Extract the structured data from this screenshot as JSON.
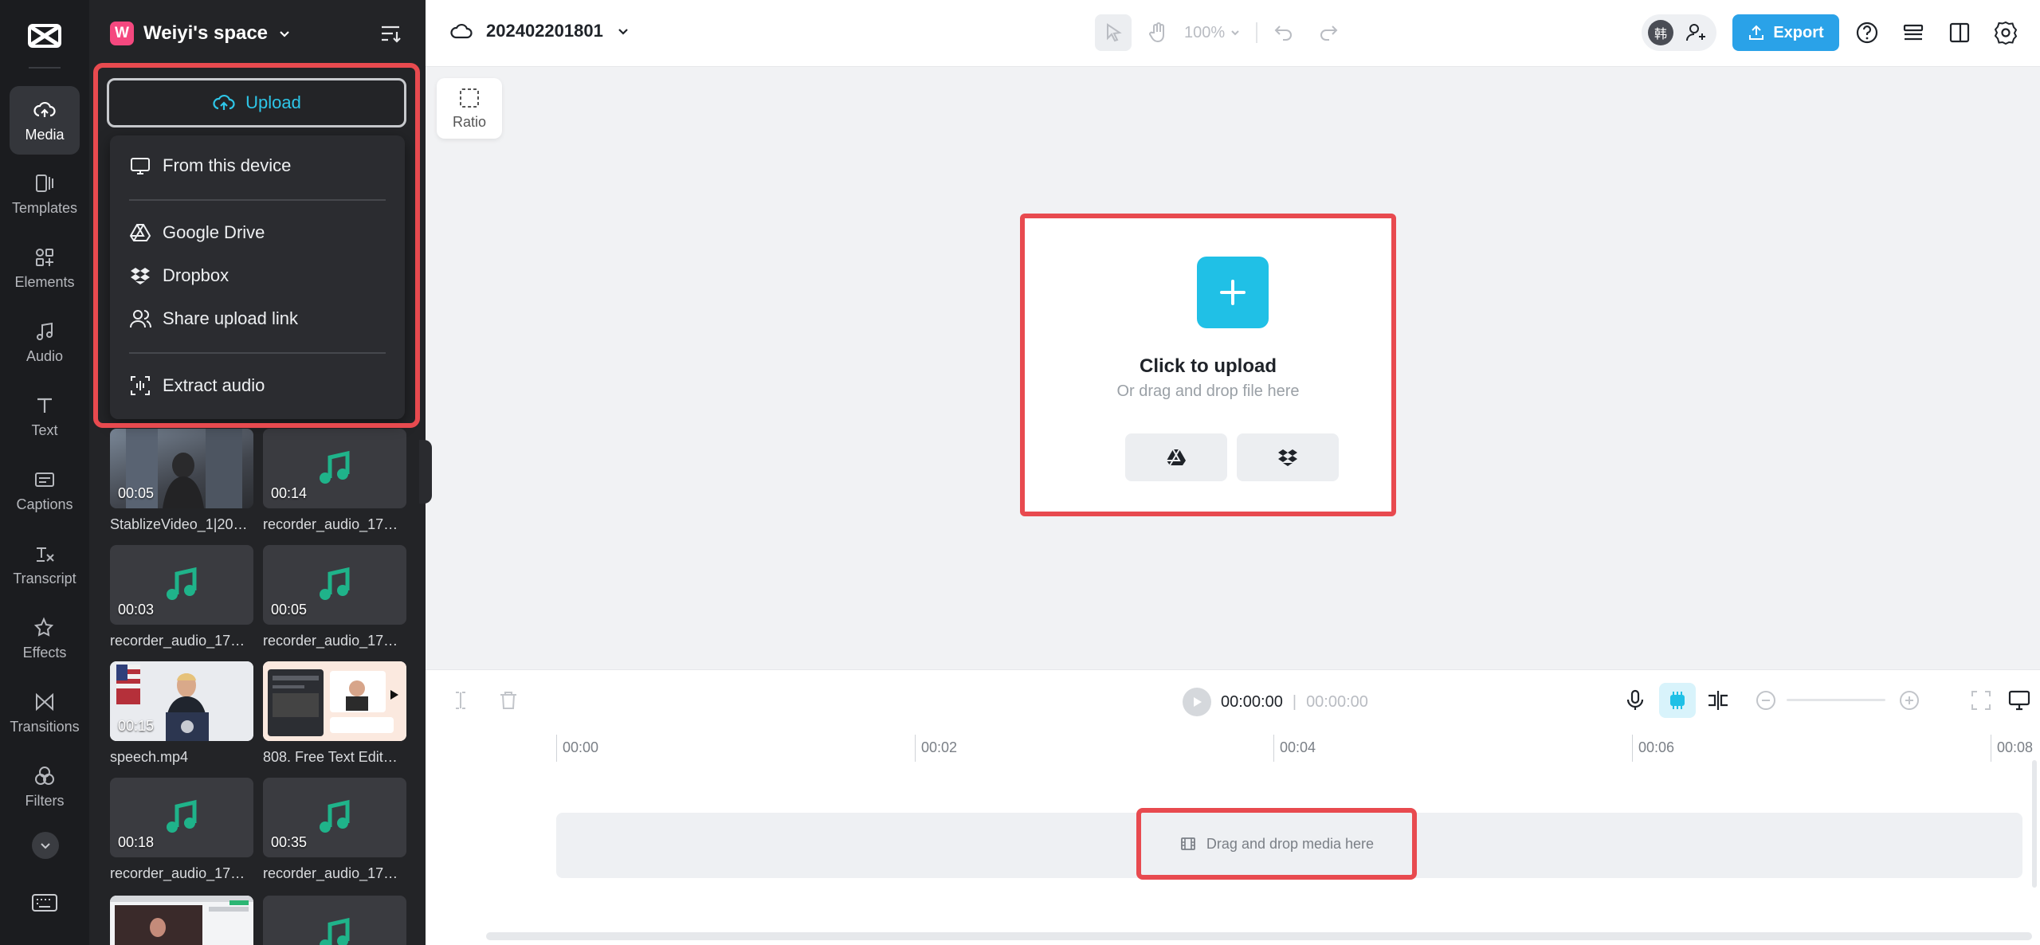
{
  "workspace": {
    "avatar_letter": "W",
    "name": "Weiyi's space"
  },
  "nav": [
    {
      "label": "Media",
      "icon": "cloud-upload-icon",
      "active": true
    },
    {
      "label": "Templates",
      "icon": "templates-icon"
    },
    {
      "label": "Elements",
      "icon": "elements-icon"
    },
    {
      "label": "Audio",
      "icon": "music-note-icon"
    },
    {
      "label": "Text",
      "icon": "text-icon"
    },
    {
      "label": "Captions",
      "icon": "captions-icon"
    },
    {
      "label": "Transcript",
      "icon": "transcript-icon"
    },
    {
      "label": "Effects",
      "icon": "effects-icon"
    },
    {
      "label": "Transitions",
      "icon": "transitions-icon"
    },
    {
      "label": "Filters",
      "icon": "filters-icon"
    }
  ],
  "upload": {
    "button_label": "Upload",
    "menu": [
      {
        "label": "From this device",
        "icon": "monitor-icon"
      },
      {
        "label": "Google Drive",
        "icon": "google-drive-icon"
      },
      {
        "label": "Dropbox",
        "icon": "dropbox-icon"
      },
      {
        "label": "Share upload link",
        "icon": "share-users-icon"
      },
      {
        "label": "Extract audio",
        "icon": "extract-audio-icon"
      }
    ]
  },
  "media": [
    {
      "duration": "00:05",
      "name": "StablizeVideo_1|20…",
      "kind": "video"
    },
    {
      "duration": "00:14",
      "name": "recorder_audio_17…",
      "kind": "audio"
    },
    {
      "duration": "00:03",
      "name": "recorder_audio_17…",
      "kind": "audio"
    },
    {
      "duration": "00:05",
      "name": "recorder_audio_17…",
      "kind": "audio"
    },
    {
      "duration": "00:15",
      "name": "speech.mp4",
      "kind": "video"
    },
    {
      "duration": "",
      "name": "808. Free Text Edit…",
      "kind": "image"
    },
    {
      "duration": "00:18",
      "name": "recorder_audio_17…",
      "kind": "audio"
    },
    {
      "duration": "00:35",
      "name": "recorder_audio_17…",
      "kind": "audio"
    },
    {
      "duration": "",
      "name": "",
      "kind": "video"
    },
    {
      "duration": "",
      "name": "",
      "kind": "audio"
    }
  ],
  "project": {
    "name": "202402201801"
  },
  "toolbar": {
    "zoom": "100%",
    "export_label": "Export",
    "collaborator_initial": "韩"
  },
  "canvas": {
    "ratio_label": "Ratio",
    "upload_title": "Click to upload",
    "upload_subtitle": "Or drag and drop file here"
  },
  "timeline": {
    "current_time": "00:00:00",
    "total_time": "00:00:00",
    "ticks": [
      "00:00",
      "00:02",
      "00:04",
      "00:06",
      "00:08"
    ],
    "drop_hint": "Drag and drop media here"
  },
  "colors": {
    "accent": "#20c0e6",
    "export": "#2aa2e8",
    "highlight": "#e84a4f",
    "audio_note": "#1fb38a"
  }
}
